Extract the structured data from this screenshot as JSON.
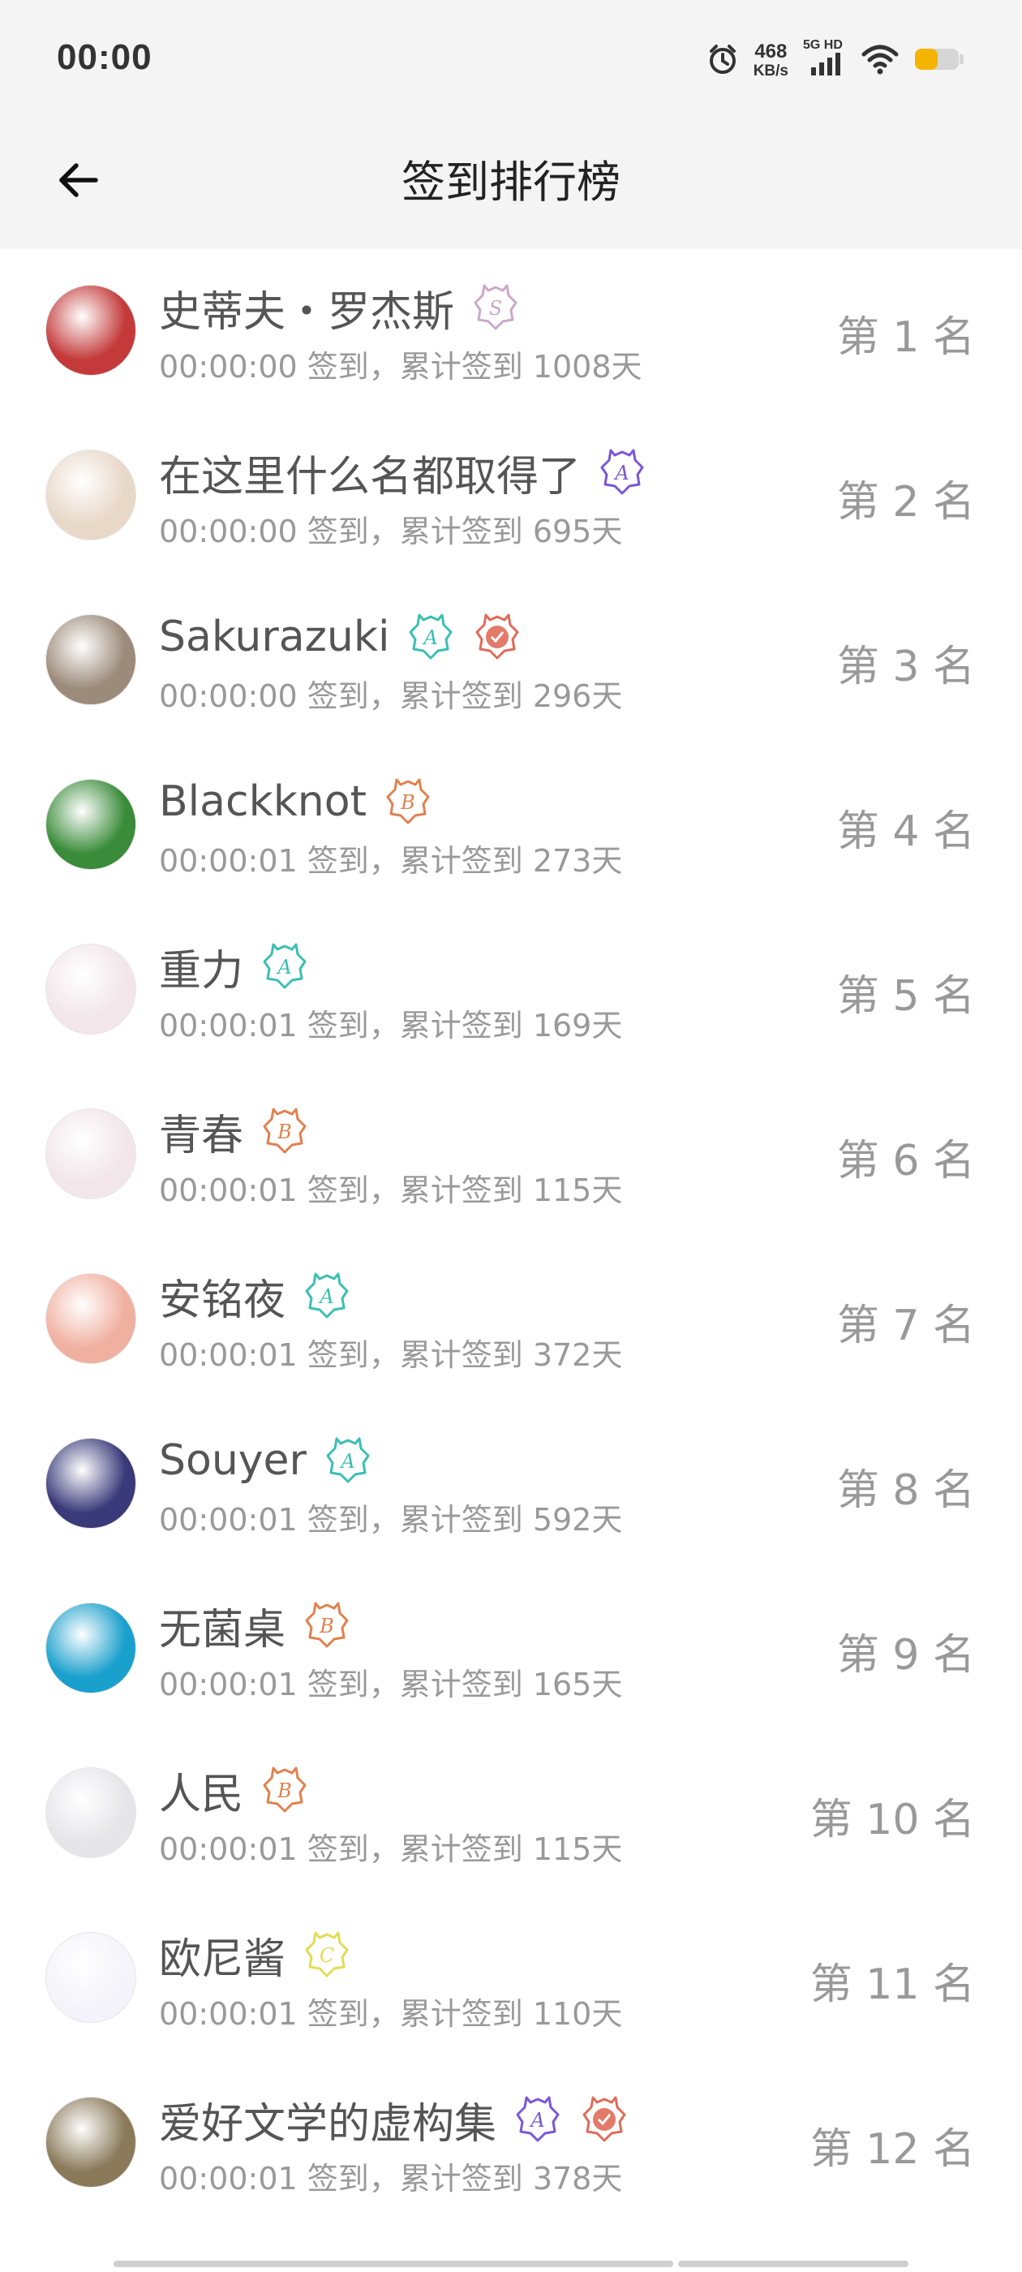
{
  "status_bar": {
    "time": "00:00",
    "net_speed_value": "468",
    "net_speed_unit": "KB/s",
    "signal_label": "5G HD",
    "battery_color": "#f5b400"
  },
  "nav": {
    "title": "签到排行榜",
    "back_icon": "arrow-left-icon"
  },
  "list": [
    {
      "name": "史蒂夫・罗杰斯",
      "meta": "00:00:00 签到，累计签到 1008天",
      "rank": "第 1 名",
      "badges": [
        {
          "letter": "S",
          "color": "#c9a9c9"
        }
      ]
    },
    {
      "name": "在这里什么名都取得了",
      "meta": "00:00:00 签到，累计签到 695天",
      "rank": "第 2 名",
      "badges": [
        {
          "letter": "A",
          "color": "#7b57d6"
        }
      ]
    },
    {
      "name": "Sakurazuki",
      "meta": "00:00:00 签到，累计签到 296天",
      "rank": "第 3 名",
      "badges": [
        {
          "letter": "A",
          "color": "#3bbfb3"
        },
        {
          "letter": "",
          "color": "#e06b5a"
        }
      ]
    },
    {
      "name": "Blackknot",
      "meta": "00:00:01 签到，累计签到 273天",
      "rank": "第 4 名",
      "badges": [
        {
          "letter": "B",
          "color": "#e0824f"
        }
      ]
    },
    {
      "name": "重力",
      "meta": "00:00:01 签到，累计签到 169天",
      "rank": "第 5 名",
      "badges": [
        {
          "letter": "A",
          "color": "#3bbfb3"
        }
      ]
    },
    {
      "name": "青春",
      "meta": "00:00:01 签到，累计签到 115天",
      "rank": "第 6 名",
      "badges": [
        {
          "letter": "B",
          "color": "#e0824f"
        }
      ]
    },
    {
      "name": "安铭夜",
      "meta": "00:00:01 签到，累计签到 372天",
      "rank": "第 7 名",
      "badges": [
        {
          "letter": "A",
          "color": "#3bbfb3"
        }
      ]
    },
    {
      "name": "Souyer",
      "meta": "00:00:01 签到，累计签到 592天",
      "rank": "第 8 名",
      "badges": [
        {
          "letter": "A",
          "color": "#3bbfb3"
        }
      ]
    },
    {
      "name": "无菌桌",
      "meta": "00:00:01 签到，累计签到 165天",
      "rank": "第 9 名",
      "badges": [
        {
          "letter": "B",
          "color": "#e0824f"
        }
      ]
    },
    {
      "name": "人民",
      "meta": "00:00:01 签到，累计签到 115天",
      "rank": "第 10 名",
      "badges": [
        {
          "letter": "B",
          "color": "#e0824f"
        }
      ]
    },
    {
      "name": "欧尼酱",
      "meta": "00:00:01 签到，累计签到 110天",
      "rank": "第 11 名",
      "badges": [
        {
          "letter": "C",
          "color": "#e3dc55"
        }
      ]
    },
    {
      "name": "爱好文学的虚构集",
      "meta": "00:00:01 签到，累计签到 378天",
      "rank": "第 12 名",
      "badges": [
        {
          "letter": "A",
          "color": "#7b57d6"
        },
        {
          "letter": "",
          "color": "#e06b5a"
        }
      ]
    }
  ],
  "avatar_colors": [
    "#c43a3a",
    "#e8d8c8",
    "#9c8a7a",
    "#3a8c3a",
    "#f2e6ea",
    "#f2e6ea",
    "#f0b0a0",
    "#3a3a7a",
    "#1aa0cc",
    "#e6e6ea",
    "#f4f4fa",
    "#8a7a5a"
  ]
}
